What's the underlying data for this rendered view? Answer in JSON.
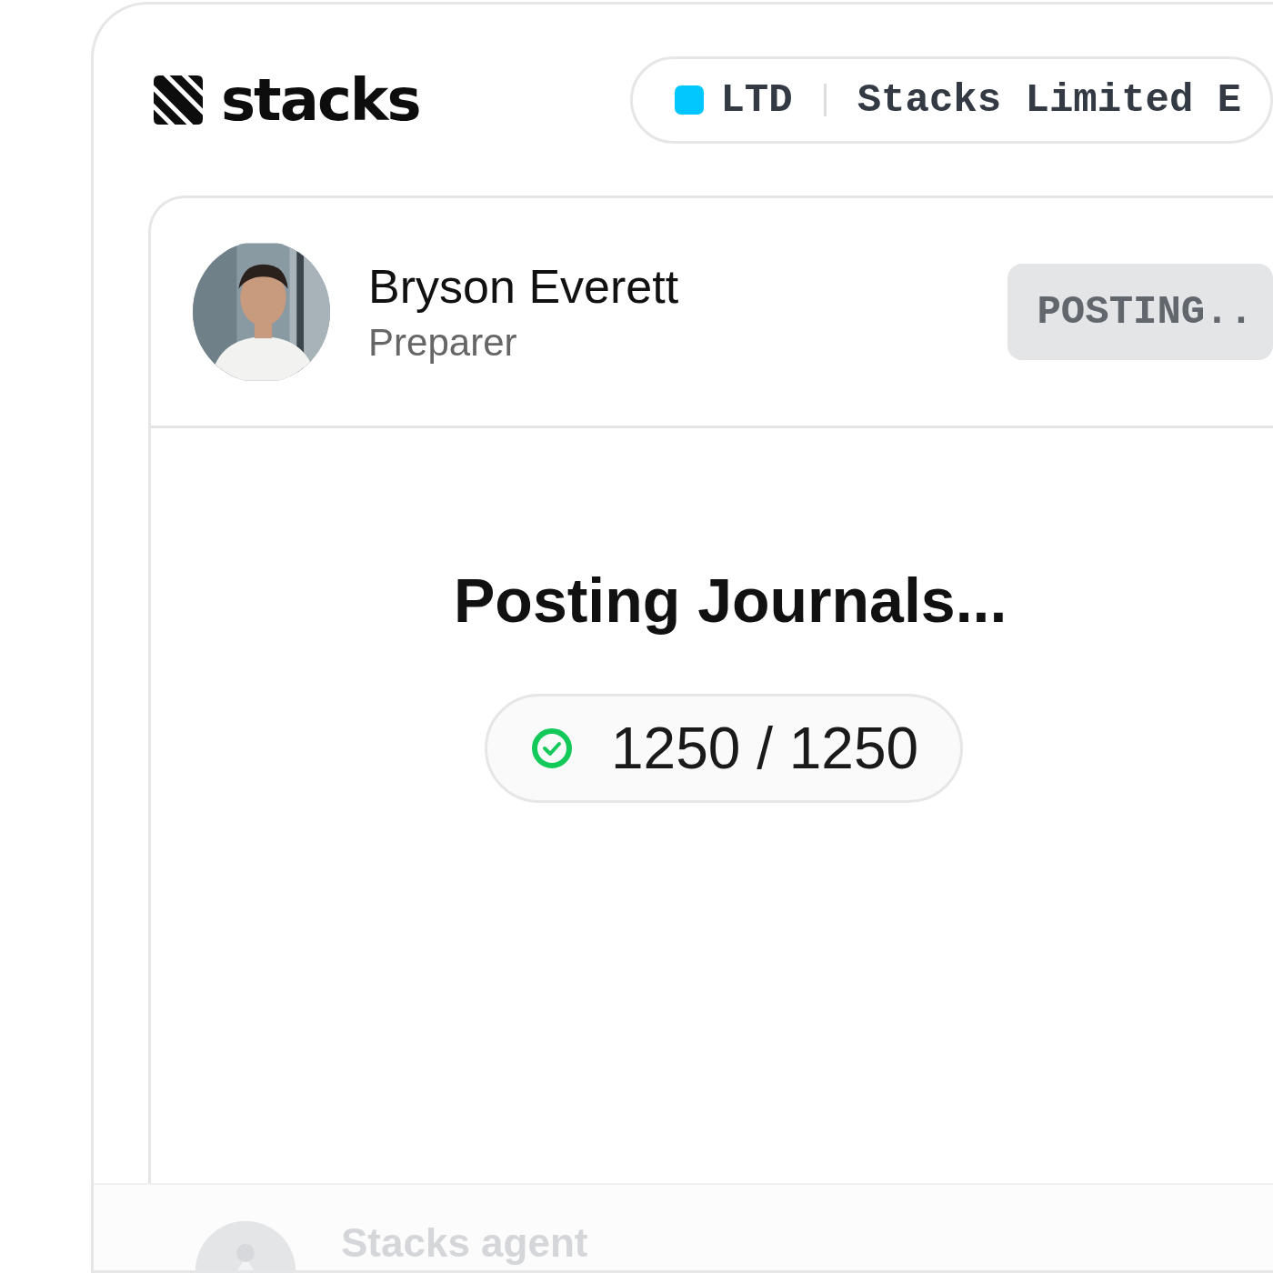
{
  "header": {
    "logo": "stacks",
    "entity": {
      "code": "LTD",
      "name": "Stacks Limited E"
    }
  },
  "preparer": {
    "name": "Bryson Everett",
    "role": "Preparer",
    "status": "POSTING.."
  },
  "progress": {
    "title": "Posting Journals...",
    "count": "1250 / 1250",
    "complete": true
  },
  "next_item": {
    "name": "Stacks agent"
  }
}
